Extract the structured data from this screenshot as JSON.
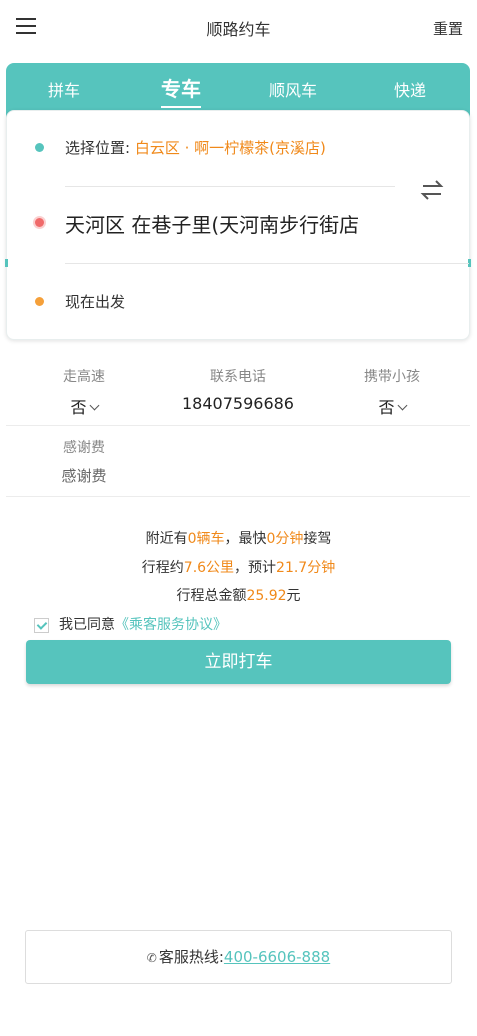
{
  "header": {
    "title": "顺路约车",
    "reset_label": "重置"
  },
  "tabs": [
    {
      "label": "拼车"
    },
    {
      "label": "专车"
    },
    {
      "label": "顺风车"
    },
    {
      "label": "快递"
    }
  ],
  "location": {
    "from_label": "选择位置:",
    "from_value": "白云区 · 啊一柠檬茶(京溪店)",
    "to_value": "天河区 在巷子里(天河南步行街店",
    "time_label": "现在出发"
  },
  "options": {
    "highway_label": "走高速",
    "highway_value": "否",
    "phone_label": "联系电话",
    "phone_value": "18407596686",
    "child_label": "携带小孩",
    "child_value": "否",
    "tip_label": "感谢费",
    "tip_placeholder": "感谢费"
  },
  "info": {
    "nearby_prefix": "附近有",
    "nearby_count": "0辆车",
    "nearby_mid": "，最快",
    "nearby_time": "0分钟",
    "nearby_suffix": "接驾",
    "trip_prefix": "行程约",
    "trip_distance": "7.6公里",
    "trip_mid": "，预计",
    "trip_time": "21.7分钟",
    "total_prefix": "行程总金额",
    "total_amount": "25.92",
    "total_suffix": "元"
  },
  "agreement": {
    "text": "我已同意",
    "link": "《乘客服务协议》",
    "checked": true
  },
  "submit_label": "立即打车",
  "hotline": {
    "label": "客服热线:",
    "number": "400-6606-888"
  },
  "colors": {
    "accent": "#56c4bd",
    "highlight": "#f0891a",
    "to_dot": "#f06a6a"
  }
}
